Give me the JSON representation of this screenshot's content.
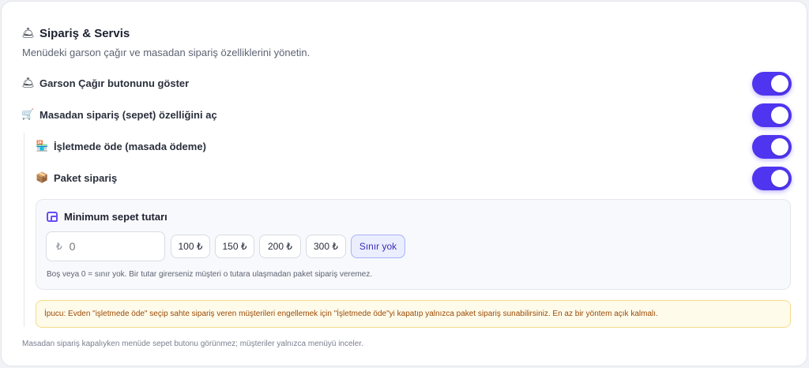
{
  "section": {
    "icon": "bellhop-bell-icon",
    "icon_glyph": "🛎",
    "title": "Sipariş & Servis",
    "subtitle": "Menüdeki garson çağır ve masadan sipariş özelliklerini yönetin."
  },
  "settings": [
    {
      "icon": "bellhop-bell-icon",
      "glyph": "🛎",
      "label": "Garson Çağır butonunu göster",
      "enabled": true
    },
    {
      "icon": "shopping-cart-icon",
      "glyph": "🛒",
      "label": "Masadan sipariş (sepet) özelliğini aç",
      "enabled": true
    },
    {
      "icon": "store-icon",
      "glyph": "🏪",
      "label": "İşletmede öde (masada ödeme)",
      "enabled": true
    },
    {
      "icon": "package-icon",
      "glyph": "📦",
      "label": "Paket sipariş",
      "enabled": true
    }
  ],
  "min_basket": {
    "icon": "wallet-icon",
    "title": "Minimum sepet tutarı",
    "currency_symbol": "₺",
    "input_value": "",
    "input_placeholder": "0",
    "presets": [
      "100 ₺",
      "150 ₺",
      "200 ₺",
      "300 ₺",
      "Sınır yok"
    ],
    "selected_preset": "Sınır yok",
    "hint": "Boş veya 0 = sınır yok. Bir tutar girerseniz müşteri o tutara ulaşmadan paket sipariş veremez."
  },
  "tip": "İpucu: Evden \"işletmede öde\" seçip sahte sipariş veren müşterileri engellemek için \"İşletmede öde\"yi kapatıp yalnızca paket sipariş sunabilirsiniz. En az bir yöntem açık kalmalı.",
  "footer": "Masadan sipariş kapalıyken menüde sepet butonu görünmez; müşteriler yalnızca menüyü inceler.",
  "colors": {
    "accent": "#4f35f0",
    "tip_bg": "#fffbea",
    "tip_text": "#9a4a06"
  }
}
